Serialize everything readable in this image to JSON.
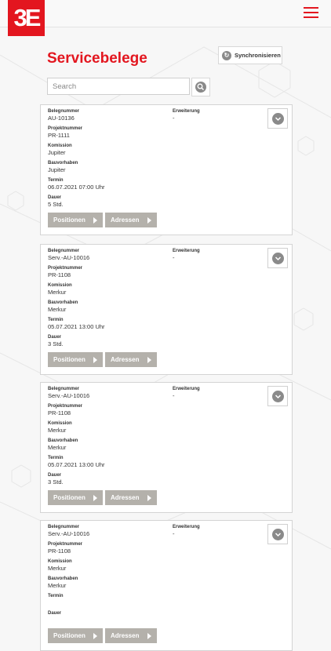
{
  "header": {
    "logo_text": "3E",
    "brand_color": "#e3161f"
  },
  "page": {
    "title": "Servicebelege"
  },
  "sync": {
    "label": "Synchronisieren",
    "icon": "sync-icon"
  },
  "search": {
    "placeholder": "Search",
    "icon": "search-icon"
  },
  "labels": {
    "belegnummer": "Belegnummer",
    "projektnummer": "Projektnummer",
    "kommission": "Komission",
    "bauvorhaben": "Bauvorhaben",
    "termin": "Termin",
    "dauer": "Dauer",
    "erweiterung": "Erweiterung",
    "positionen_btn": "Positionen",
    "adressen_btn": "Adressen"
  },
  "cards": [
    {
      "belegnummer": "AU-10136",
      "projektnummer": "PR-1111",
      "kommission": "Jupiter",
      "bauvorhaben": "Jupiter",
      "termin": "06.07.2021 07:00 Uhr",
      "dauer": "5 Std.",
      "erweiterung": "-"
    },
    {
      "belegnummer": "Serv.-AU-10016",
      "projektnummer": "PR-1108",
      "kommission": "Merkur",
      "bauvorhaben": "Merkur",
      "termin": "05.07.2021 13:00 Uhr",
      "dauer": "3 Std.",
      "erweiterung": "-"
    },
    {
      "belegnummer": "Serv.-AU-10016",
      "projektnummer": "PR-1108",
      "kommission": "Merkur",
      "bauvorhaben": "Merkur",
      "termin": "05.07.2021 13:00 Uhr",
      "dauer": "3 Std.",
      "erweiterung": "-"
    },
    {
      "belegnummer": "Serv.-AU-10016",
      "projektnummer": "PR-1108",
      "kommission": "Merkur",
      "bauvorhaben": "Merkur",
      "termin": "",
      "dauer": "",
      "erweiterung": "-"
    }
  ]
}
